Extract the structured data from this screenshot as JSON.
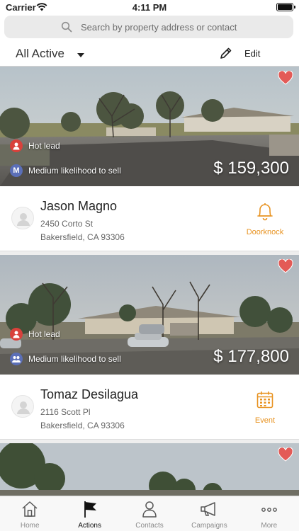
{
  "status_bar": {
    "carrier": "Carrier",
    "time": "4:11 PM"
  },
  "search": {
    "placeholder": "Search by property address or contact"
  },
  "filter": {
    "label": "All Active",
    "edit_label": "Edit"
  },
  "colors": {
    "accent": "#e89321",
    "hot": "#d9413b",
    "medium": "#5b6fb8",
    "heart": "#e35b57"
  },
  "listings": [
    {
      "tag_hot": "Hot lead",
      "tag_likelihood": "Medium likelihood to sell",
      "likelihood_badge": "M",
      "price": "$ 159,300",
      "name": "Jason Magno",
      "address_line1": "2450 Corto St",
      "address_line2": "Bakersfield, CA 93306",
      "action_label": "Doorknock",
      "action_icon": "bell-icon",
      "favorited": true
    },
    {
      "tag_hot": "Hot lead",
      "tag_likelihood": "Medium likelihood to sell",
      "likelihood_badge": "",
      "price": "$ 177,800",
      "name": "Tomaz Desilagua",
      "address_line1": "2116 Scott Pl",
      "address_line2": "Bakersfield, CA 93306",
      "action_label": "Event",
      "action_icon": "calendar-icon",
      "favorited": true
    },
    {
      "favorited": true
    }
  ],
  "tabs": [
    {
      "label": "Home",
      "icon": "home-icon"
    },
    {
      "label": "Actions",
      "icon": "flag-icon",
      "active": true
    },
    {
      "label": "Contacts",
      "icon": "person-icon"
    },
    {
      "label": "Campaigns",
      "icon": "megaphone-icon"
    },
    {
      "label": "More",
      "icon": "more-icon"
    }
  ]
}
